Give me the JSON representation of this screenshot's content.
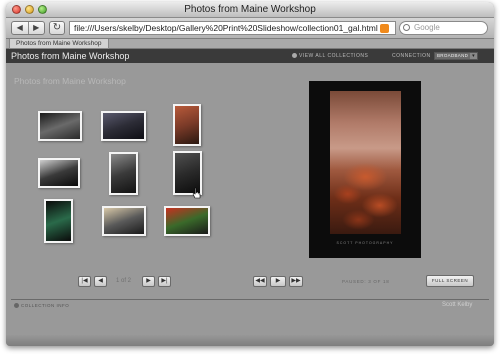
{
  "window": {
    "title": "Photos from Maine Workshop"
  },
  "browser": {
    "back_icon": "back-arrow-icon",
    "forward_icon": "forward-arrow-icon",
    "reload_icon": "reload-icon",
    "url": "file:///Users/skelby/Desktop/Gallery%20Print%20Slideshow/collection01_gal.html",
    "search_placeholder": "Google",
    "tab_label": "Photos from Maine Workshop"
  },
  "gallery": {
    "header_title": "Photos from Maine Workshop",
    "view_all": "VIEW ALL COLLECTIONS",
    "connection_label": "CONNECTION",
    "connection_value": "BROADBAND",
    "collection_title": "Photos from Maine Workshop",
    "thumbnails": [
      {
        "name": "coastal rocks",
        "colors": [
          "#1a1a1a",
          "#6a6a6a",
          "#2a2a2a"
        ]
      },
      {
        "name": "shoreline dusk",
        "colors": [
          "#5a5a6e",
          "#2c2c36",
          "#0e0e14"
        ]
      },
      {
        "name": "sunrise rocks",
        "colors": [
          "#b85a3a",
          "#7a3a28",
          "#2a1810"
        ]
      },
      {
        "name": "dark trees",
        "colors": [
          "#cfcfcf",
          "#3a3a3a",
          "#0a0a0a"
        ]
      },
      {
        "name": "misty tree",
        "colors": [
          "#8a8a8a",
          "#3a3a3a",
          "#121212"
        ]
      },
      {
        "name": "fog figure",
        "colors": [
          "#505050",
          "#2a2a2a",
          "#0c0c0c"
        ]
      },
      {
        "name": "green light",
        "colors": [
          "#0a0a0a",
          "#2a6a4a",
          "#0a0a0a"
        ]
      },
      {
        "name": "harbor sunset",
        "colors": [
          "#d8c8a8",
          "#5a5a5a",
          "#1a1a1a"
        ]
      },
      {
        "name": "red flowers",
        "colors": [
          "#c83020",
          "#3a6a2a",
          "#1a1a1a"
        ]
      }
    ],
    "preview_caption": "SCOTT PHOTOGRAPHY",
    "page_counter": "1 of 2",
    "slide_status": "PAUSED: 3 OF 18",
    "full_screen": "FULL SCREEN",
    "collection_info": "COLLECTION INFO",
    "author": "Scott Kelby"
  },
  "accent": "#3a3a3a"
}
